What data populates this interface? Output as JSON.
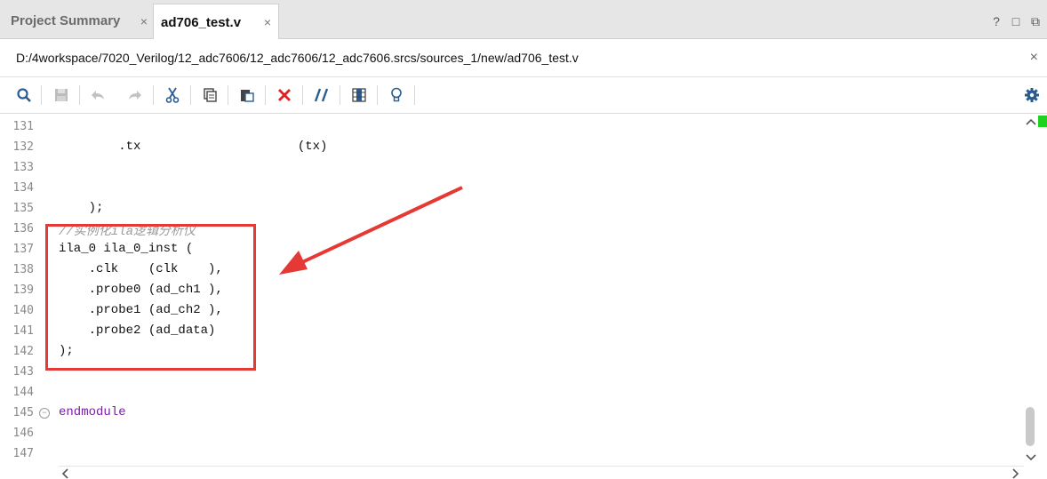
{
  "tabs": [
    {
      "label": "Project Summary",
      "close": "×",
      "active": false
    },
    {
      "label": "ad706_test.v",
      "close": "×",
      "active": true
    }
  ],
  "window_controls": [
    "?",
    "□",
    "⧉"
  ],
  "file_path": "D:/4workspace/7020_Verilog/12_adc7606/12_adc7606/12_adc7606.srcs/sources_1/new/ad706_test.v",
  "path_close": "×",
  "toolbar": {
    "icons": [
      "search-icon",
      "save-icon",
      "undo-icon",
      "redo-icon",
      "cut-icon",
      "copy-icon",
      "paste-icon",
      "delete-icon",
      "comment-toggle-icon",
      "column-select-icon",
      "lightbulb-icon",
      "settings-gear-icon"
    ]
  },
  "editor": {
    "lines": [
      {
        "num": "131",
        "text": ""
      },
      {
        "num": "132",
        "text": "        .tx                     (tx)"
      },
      {
        "num": "133",
        "text": ""
      },
      {
        "num": "134",
        "text": ""
      },
      {
        "num": "135",
        "text": "    );"
      },
      {
        "num": "136",
        "text": "//实例化ila逻辑分析仪",
        "style": "comment"
      },
      {
        "num": "137",
        "text": "ila_0 ila_0_inst ("
      },
      {
        "num": "138",
        "text": "    .clk    (clk    ),"
      },
      {
        "num": "139",
        "text": "    .probe0 (ad_ch1 ),"
      },
      {
        "num": "140",
        "text": "    .probe1 (ad_ch2 ),"
      },
      {
        "num": "141",
        "text": "    .probe2 (ad_data)"
      },
      {
        "num": "142",
        "text": ");"
      },
      {
        "num": "143",
        "text": ""
      },
      {
        "num": "144",
        "text": ""
      },
      {
        "num": "145",
        "text": "endmodule",
        "style": "keyword",
        "fold": "−"
      },
      {
        "num": "146",
        "text": ""
      },
      {
        "num": "147",
        "text": ""
      }
    ]
  },
  "colors": {
    "annotation_red": "#e53935",
    "keyword_purple": "#7a1fa2",
    "comment_gray": "#9a9a9a",
    "marker_green": "#1fd21f"
  }
}
